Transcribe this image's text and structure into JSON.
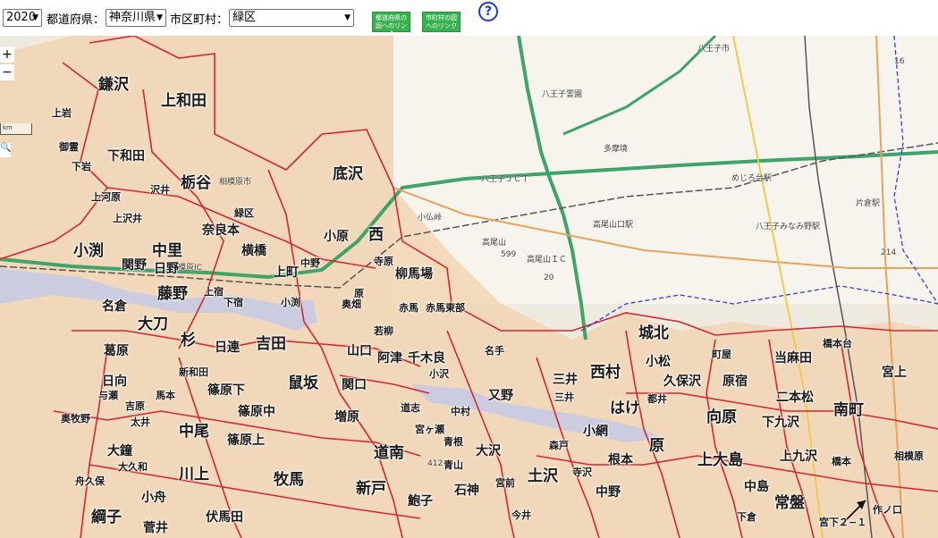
{
  "toolbar": {
    "year": "2020",
    "pref_label": "都道府県：",
    "pref_value": "神奈川県",
    "city_label": "市区町村：",
    "city_value": "緑区",
    "pref_link": "都道府県の図へのリンク",
    "city_link": "市町村の図へのリンク",
    "help": "?"
  },
  "map_controls": {
    "zoom_in": "+",
    "zoom_out": "−",
    "scale": "km",
    "search_icon": "magnifier-icon"
  },
  "districts": [
    "鎌沢",
    "上和田",
    "上岩",
    "御霊",
    "下岩",
    "下和田",
    "上河原",
    "上沢井",
    "沢井",
    "栃谷",
    "緑区",
    "底沢",
    "奈良本",
    "小原",
    "西",
    "小渕",
    "中里",
    "横橋",
    "関野",
    "日野",
    "上町",
    "中野",
    "寺原",
    "柳馬場",
    "藤野",
    "名倉",
    "上宿",
    "下宿",
    "小渕",
    "原",
    "奥畑",
    "赤馬",
    "赤馬東部",
    "大刀",
    "杉",
    "日連",
    "吉田",
    "若柳",
    "葛原",
    "山口",
    "阿津",
    "千木良",
    "名手",
    "城北",
    "新和田",
    "篠原下",
    "鼠坂",
    "関口",
    "小松",
    "町屋",
    "当麻田",
    "橋本台",
    "日向",
    "与瀬",
    "馬本",
    "篠原中",
    "小沢",
    "又野",
    "三井",
    "西村",
    "久保沢",
    "原宿",
    "二本松",
    "宮上",
    "奥牧野",
    "吉原",
    "太井",
    "道志",
    "中村",
    "三井",
    "はけ",
    "都井",
    "向原",
    "下九沢",
    "南町",
    "大鐘",
    "中尾",
    "篠原上",
    "増原",
    "宮ヶ瀬",
    "青根",
    "森戸",
    "小網",
    "原",
    "上大島",
    "上九沢",
    "橋本",
    "舟久保",
    "大久和",
    "川上",
    "道南",
    "牧馬",
    "青山",
    "大沢",
    "根本",
    "寺沢",
    "相模原",
    "小舟",
    "新戸",
    "石神",
    "宮前",
    "土沢",
    "中野",
    "中島",
    "常盤",
    "綱子",
    "菅井",
    "伏馬田",
    "鮑子",
    "今井",
    "下倉",
    "作ノ口",
    "宮下２−１"
  ],
  "map_labels": [
    "八王子市",
    "八王子霊園",
    "多摩境",
    "相模原市",
    "小仏峠",
    "高尾山",
    "599",
    "高尾山口駅",
    "八王子ＪＣＴ",
    "高尾山ＩＣ",
    "めじろ台駅",
    "片倉駅",
    "八王子みなみ野駅",
    "相模原IC",
    "214",
    "16",
    "20",
    "412"
  ],
  "colors": {
    "district_border": "#d7262e",
    "district_fill": "#f5d7b4",
    "highway": "#3fa46a",
    "water": "#b9bfe0"
  }
}
